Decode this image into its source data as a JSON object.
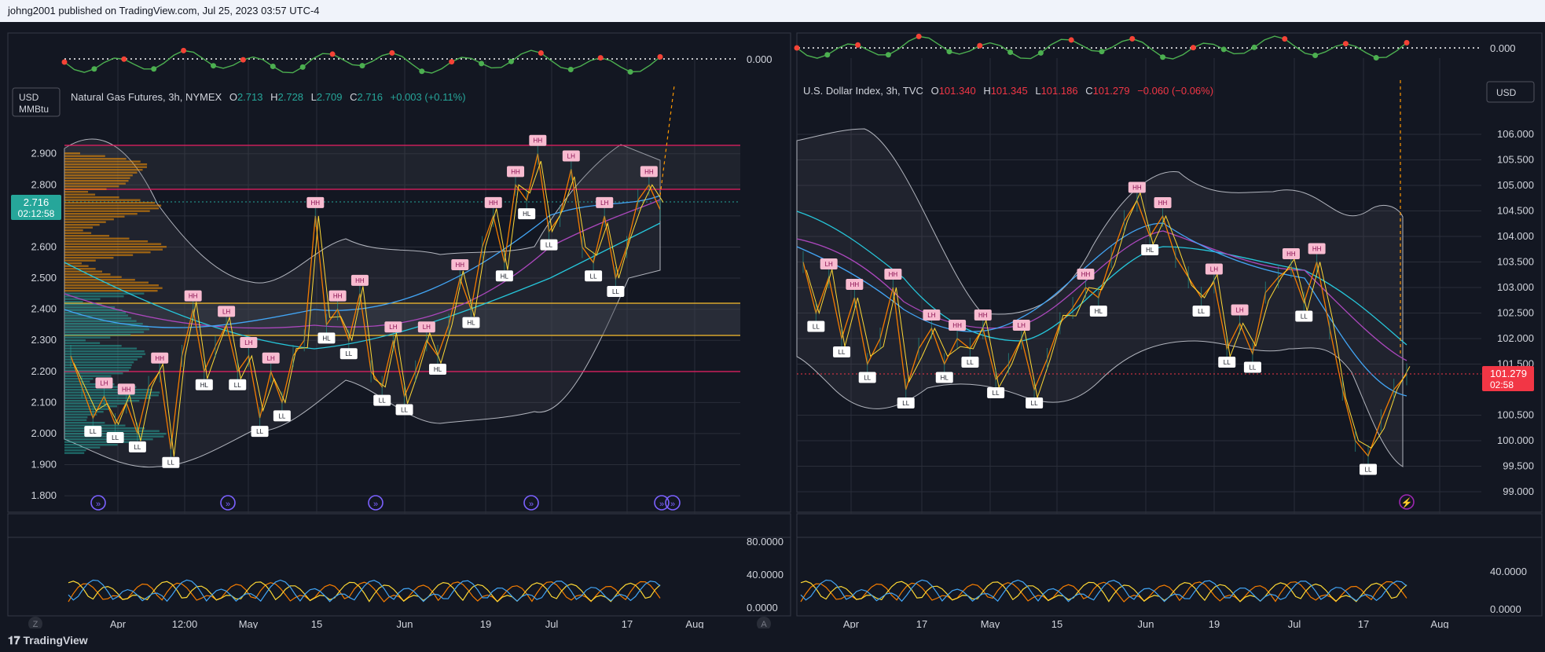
{
  "header": {
    "publisher": "johng2001 published on TradingView.com, Jul 25, 2023 03:57 UTC-4"
  },
  "footer": {
    "brand": "TradingView"
  },
  "left_chart": {
    "legend": {
      "name": "Natural Gas Futures, 3h, NYMEX",
      "o_label": "O",
      "o": "2.713",
      "h_label": "H",
      "h": "2.728",
      "l_label": "L",
      "l": "2.709",
      "c_label": "C",
      "c": "2.716",
      "change": "+0.003 (+0.11%)"
    },
    "unit_line1": "USD",
    "unit_line2": "MMBtu",
    "price_tag": "2.716",
    "countdown": "02:12:58",
    "osc_zero": "0.000",
    "lower_ticks": [
      "80.0000",
      "40.0000",
      "0.0000"
    ],
    "corner_left": "Z",
    "corner_right": "A"
  },
  "right_chart": {
    "legend": {
      "name": "U.S. Dollar Index, 3h, TVC",
      "o_label": "O",
      "o": "101.340",
      "h_label": "H",
      "h": "101.345",
      "l_label": "L",
      "l": "101.186",
      "c_label": "C",
      "c": "101.279",
      "change": "−0.060 (−0.06%)"
    },
    "unit": "USD",
    "price_tag": "101.279",
    "countdown": "02:58",
    "osc_zero": "0.000",
    "lower_ticks": [
      "40.0000",
      "0.0000"
    ]
  },
  "chart_data": [
    {
      "type": "line",
      "title": "Natural Gas Futures, 3h, NYMEX",
      "ylim": [
        1.78,
        2.96
      ],
      "y_ticks": [
        1.8,
        1.9,
        2.0,
        2.1,
        2.2,
        2.3,
        2.4,
        2.5,
        2.6,
        2.7,
        2.8,
        2.9
      ],
      "x_ticks": [
        "Apr",
        "12:00",
        "May",
        "15",
        "Jun",
        "19",
        "Jul",
        "17",
        "Aug"
      ],
      "series": [
        {
          "values": [
            2.25,
            2.15,
            2.05,
            2.12,
            2.03,
            2.1,
            2.0,
            2.15,
            2.2,
            1.95,
            2.25,
            2.4,
            2.2,
            2.28,
            2.35,
            2.2,
            2.25,
            2.05,
            2.2,
            2.1,
            2.25,
            2.3,
            2.7,
            2.35,
            2.4,
            2.3,
            2.45,
            2.2,
            2.15,
            2.3,
            2.12,
            2.2,
            2.3,
            2.25,
            2.35,
            2.5,
            2.4,
            2.6,
            2.7,
            2.55,
            2.8,
            2.75,
            2.9,
            2.65,
            2.7,
            2.85,
            2.6,
            2.55,
            2.7,
            2.5,
            2.6,
            2.75,
            2.8,
            2.72
          ]
        }
      ],
      "annotations": [
        "HH",
        "LH",
        "HL",
        "LL"
      ]
    },
    {
      "type": "line",
      "title": "U.S. Dollar Index, 3h, TVC",
      "ylim": [
        98.8,
        106.6
      ],
      "y_ticks": [
        99.0,
        99.5,
        100.0,
        100.5,
        101.5,
        102.0,
        102.5,
        103.0,
        103.5,
        104.0,
        104.5,
        105.0,
        105.5,
        106.0
      ],
      "x_ticks": [
        "Apr",
        "17",
        "May",
        "15",
        "Jun",
        "19",
        "Jul",
        "17",
        "Aug"
      ],
      "series": [
        {
          "values": [
            103.5,
            102.5,
            103.2,
            102.0,
            102.8,
            101.5,
            102.0,
            103.0,
            101.0,
            101.8,
            102.2,
            101.5,
            102.0,
            101.8,
            102.2,
            101.2,
            101.5,
            102.0,
            101.0,
            101.6,
            102.3,
            102.6,
            103.0,
            102.8,
            103.6,
            104.3,
            104.7,
            104.0,
            104.4,
            103.6,
            103.2,
            102.8,
            103.1,
            101.8,
            102.3,
            101.7,
            102.9,
            103.2,
            103.4,
            102.7,
            103.5,
            102.2,
            101.0,
            100.0,
            99.7,
            100.4,
            101.0,
            101.3
          ]
        }
      ],
      "annotations": [
        "HH",
        "LH",
        "HL",
        "LL"
      ]
    }
  ]
}
